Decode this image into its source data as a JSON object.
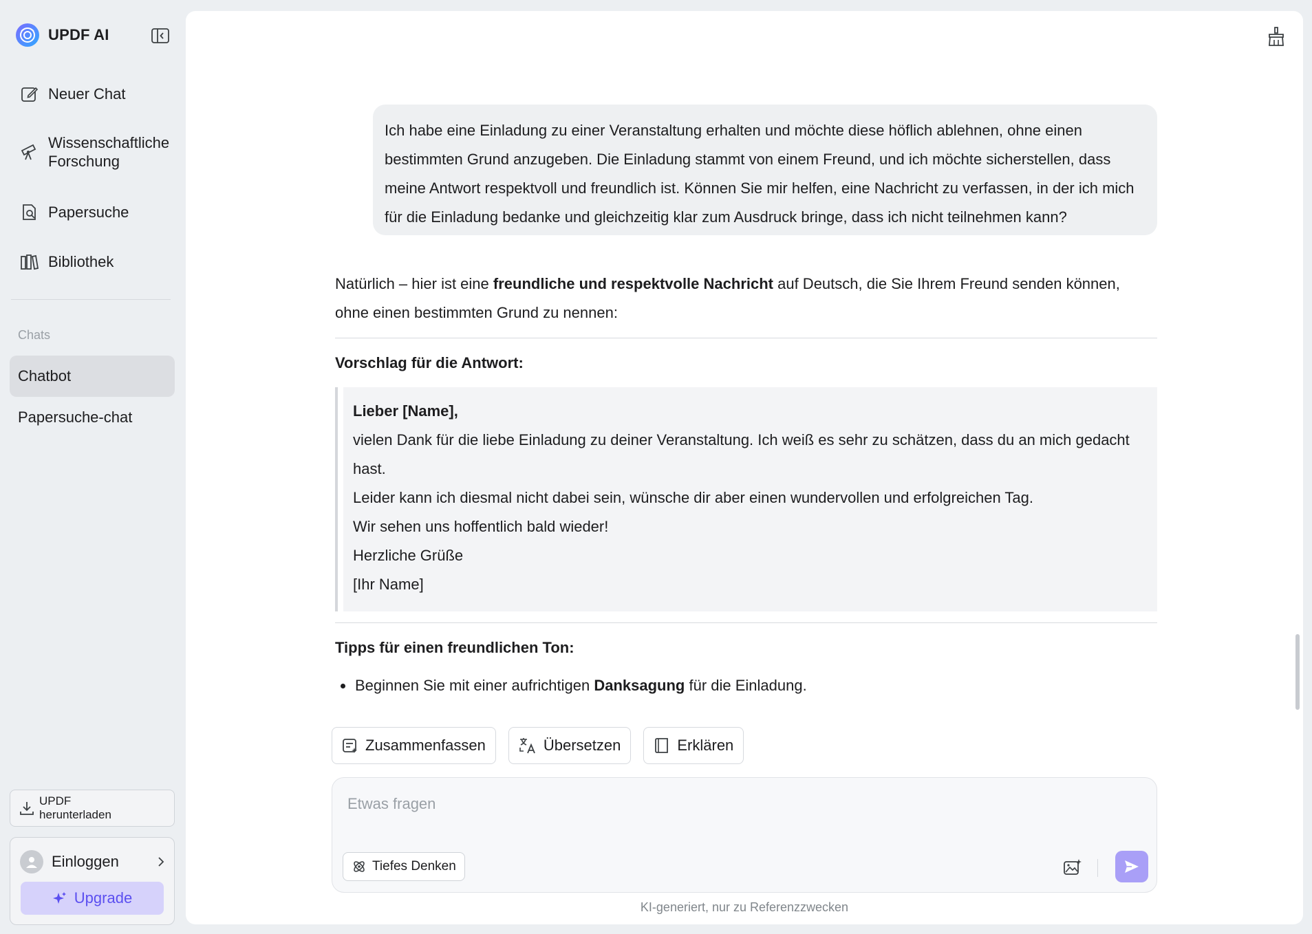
{
  "app": {
    "name": "UPDF AI"
  },
  "sidebar": {
    "nav": [
      {
        "label": "Neuer Chat",
        "icon": "edit-icon"
      },
      {
        "label": "Wissenschaftliche Forschung",
        "icon": "telescope-icon"
      },
      {
        "label": "Papersuche",
        "icon": "document-search-icon"
      },
      {
        "label": "Bibliothek",
        "icon": "library-icon"
      }
    ],
    "section_label": "Chats",
    "chats": [
      {
        "label": "Chatbot",
        "active": true
      },
      {
        "label": "Papersuche-chat",
        "active": false
      }
    ],
    "download_label": "UPDF herunterladen",
    "login_label": "Einloggen",
    "upgrade_label": "Upgrade"
  },
  "conversation": {
    "user_message": "Ich habe eine Einladung zu einer Veranstaltung erhalten und möchte diese höflich ablehnen, ohne einen bestimmten Grund anzugeben. Die Einladung stammt von einem Freund, und ich möchte sicherstellen, dass meine Antwort respektvoll und freundlich ist. Können Sie mir helfen, eine Nachricht zu verfassen, in der ich mich für die Einladung bedanke und gleichzeitig klar zum Ausdruck bringe, dass ich nicht teilnehmen kann?",
    "answer": {
      "intro_pre": "Natürlich – hier ist eine ",
      "intro_bold": "freundliche und respektvolle Nachricht",
      "intro_post": " auf Deutsch, die Sie Ihrem Freund senden können, ohne einen bestimmten Grund zu nennen:",
      "proposal_heading": "Vorschlag für die Antwort:",
      "quote": {
        "salutation": "Lieber [Name],",
        "line1": "vielen Dank für die liebe Einladung zu deiner Veranstaltung. Ich weiß es sehr zu schätzen, dass du an mich gedacht hast.",
        "line2": "Leider kann ich diesmal nicht dabei sein, wünsche dir aber einen wundervollen und erfolgreichen Tag.",
        "line3": "Wir sehen uns hoffentlich bald wieder!",
        "line4": "Herzliche Grüße",
        "line5": "[Ihr Name]"
      },
      "tips_heading": "Tipps für einen freundlichen Ton:",
      "tip1_pre": "Beginnen Sie mit einer aufrichtigen ",
      "tip1_bold": "Danksagung",
      "tip1_post": " für die Einladung."
    }
  },
  "actions": {
    "summarize": "Zusammenfassen",
    "translate": "Übersetzen",
    "explain": "Erklären"
  },
  "composer": {
    "placeholder": "Etwas fragen",
    "value": "",
    "deep_think_label": "Tiefes Denken"
  },
  "footnote": "KI-generiert, nur zu Referenzzwecken",
  "colors": {
    "accent": "#5b4ff0",
    "upgrade_bg": "#d6d2fb",
    "send_bg": "#a99ff7",
    "active_chat_bg": "#dcdee2"
  }
}
